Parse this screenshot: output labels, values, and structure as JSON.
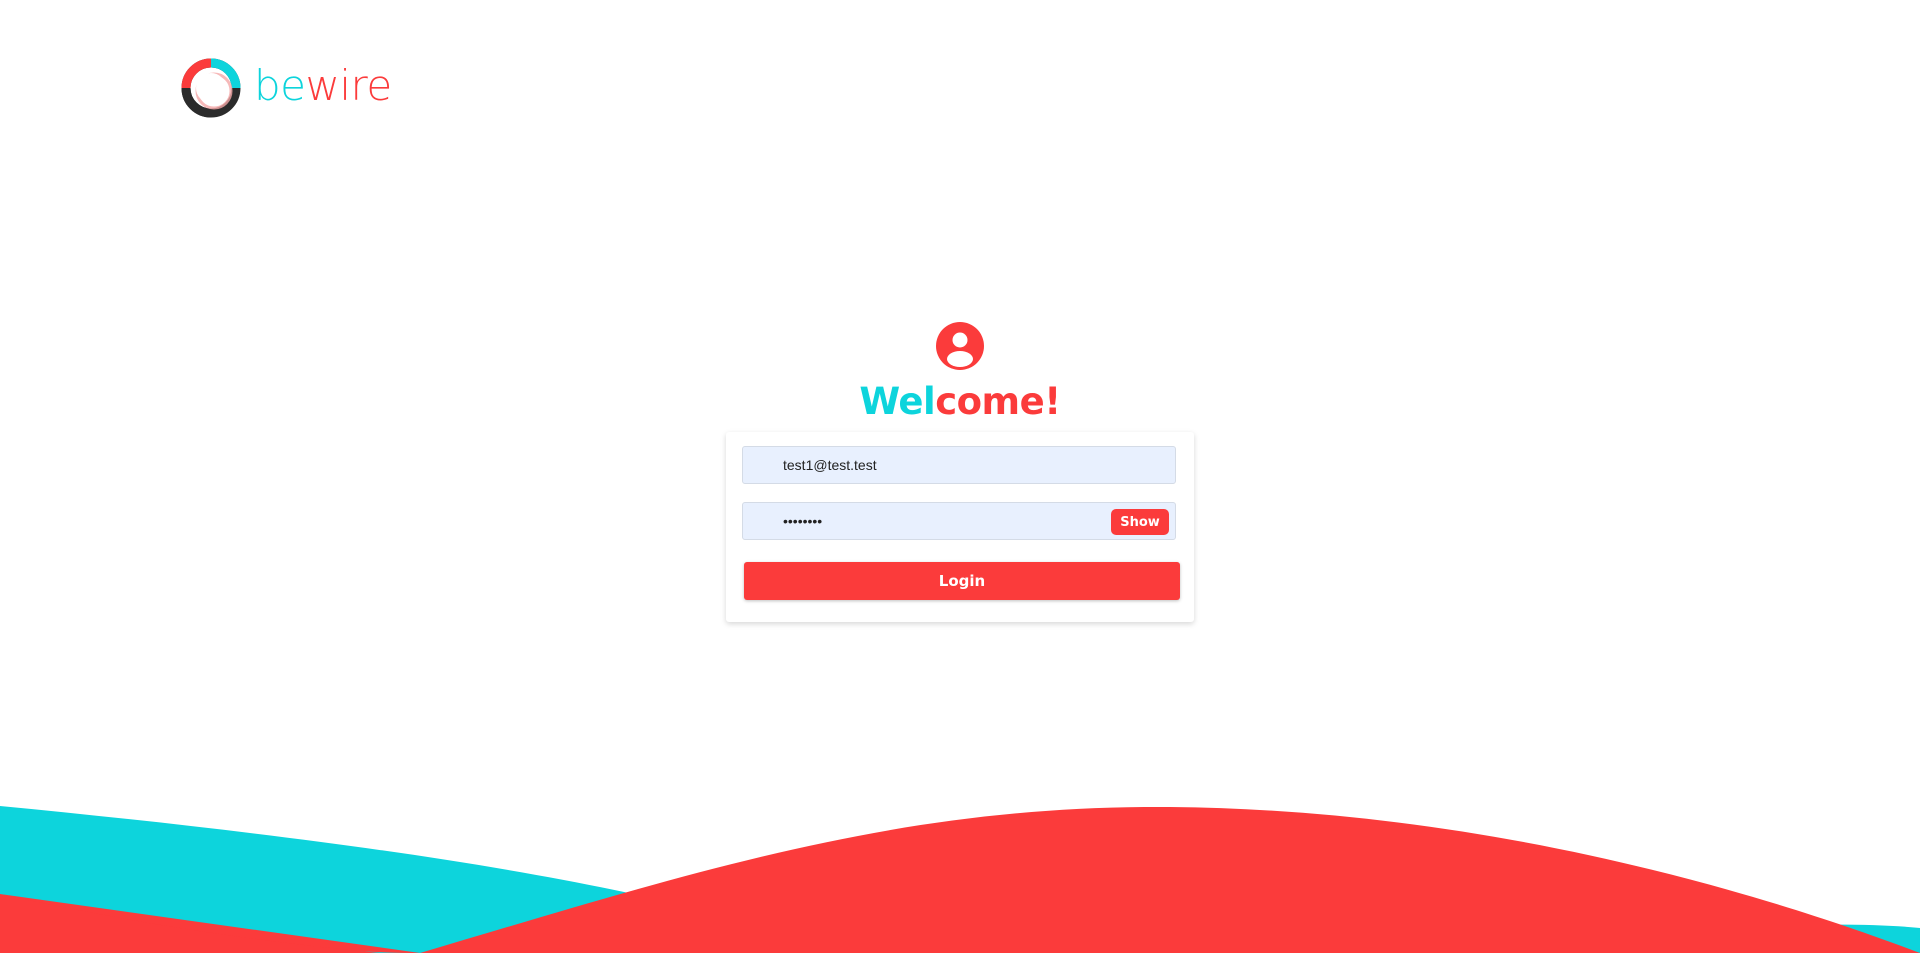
{
  "brand": {
    "name_part1": "be",
    "name_part2": "wire",
    "logo_icon": "ring-logo-icon"
  },
  "header": {
    "avatar_icon": "user-circle-icon",
    "welcome_part1": "Wel",
    "welcome_part2": "come!"
  },
  "form": {
    "email_value": "test1@test.test",
    "password_value": "••••••••",
    "show_label": "Show",
    "login_label": "Login"
  },
  "colors": {
    "accent_red": "#fb3b3b",
    "accent_cyan": "#0dd4dc",
    "field_bg": "#e8f0fe"
  }
}
